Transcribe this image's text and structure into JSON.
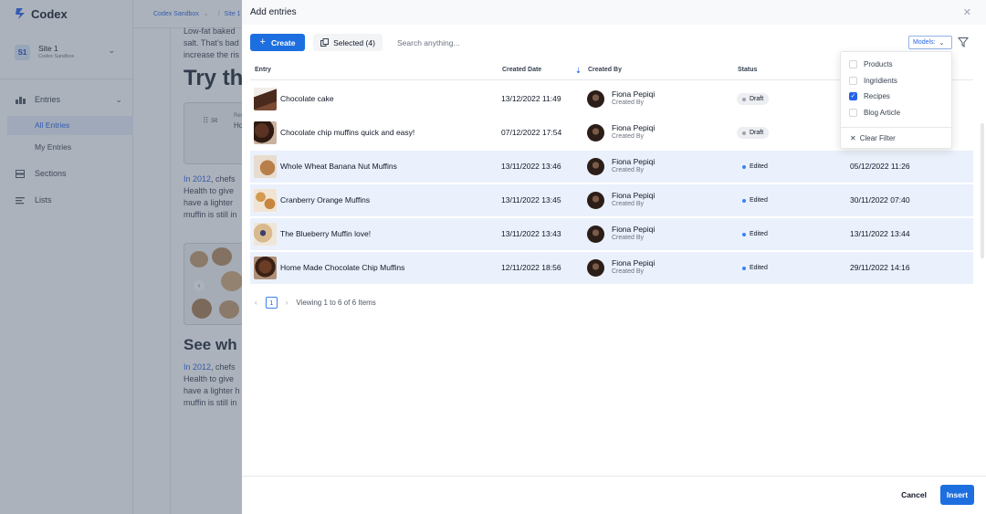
{
  "app": {
    "logo_text": "Codex",
    "site": {
      "badge": "S1",
      "name": "Site 1",
      "subtitle": "Codex Sandbox"
    },
    "nav": {
      "entries_label": "Entries",
      "all_entries_label": "All Entries",
      "my_entries_label": "My Entries",
      "sections_label": "Sections",
      "lists_label": "Lists"
    },
    "breadcrumb": [
      "Codex Sandbox",
      "Site 1"
    ],
    "background": {
      "line1": "Low-fat baked",
      "line2": "salt. That’s bad",
      "line3": "increase the ris",
      "heading1": "Try th",
      "card_label": "Rec",
      "card_title": "Ho",
      "para_link": "In 2012",
      "para_a": ", chefs",
      "para_b": "Health to give",
      "para_c": "have a lighter",
      "para_d": "muffin is still in",
      "heading2": "See wh",
      "para2_link": "In 2012",
      "para2_a": ", chefs",
      "para2_b": "Health to give",
      "para2_c": "have a lighter h",
      "para2_d": "muffin is still in"
    }
  },
  "modal": {
    "title": "Add entries",
    "create_label": "Create",
    "selected_label": "Selected (4)",
    "search_placeholder": "Search anything...",
    "models_label": "Models:",
    "columns": {
      "entry": "Entry",
      "created_date": "Created Date",
      "created_by": "Created By",
      "status": "Status"
    },
    "rows": [
      {
        "name": "Chocolate cake",
        "created_date": "13/12/2022 11:49",
        "author": "Fiona Pepiqi",
        "author_role": "Created By",
        "status": "Draft",
        "modified_date": "",
        "selected": false
      },
      {
        "name": "Chocolate chip muffins quick and easy!",
        "created_date": "07/12/2022 17:54",
        "author": "Fiona Pepiqi",
        "author_role": "Created By",
        "status": "Draft",
        "modified_date": "",
        "selected": false
      },
      {
        "name": "Whole Wheat Banana Nut Muffins",
        "created_date": "13/11/2022 13:46",
        "author": "Fiona Pepiqi",
        "author_role": "Created By",
        "status": "Edited",
        "modified_date": "05/12/2022 11:26",
        "selected": true
      },
      {
        "name": "Cranberry Orange Muffins",
        "created_date": "13/11/2022 13:45",
        "author": "Fiona Pepiqi",
        "author_role": "Created By",
        "status": "Edited",
        "modified_date": "30/11/2022 07:40",
        "selected": true
      },
      {
        "name": "The Blueberry Muffin love!",
        "created_date": "13/11/2022 13:43",
        "author": "Fiona Pepiqi",
        "author_role": "Created By",
        "status": "Edited",
        "modified_date": "13/11/2022 13:44",
        "selected": true
      },
      {
        "name": "Home Made Chocolate Chip Muffins",
        "created_date": "12/11/2022 18:56",
        "author": "Fiona Pepiqi",
        "author_role": "Created By",
        "status": "Edited",
        "modified_date": "29/11/2022 14:16",
        "selected": true
      }
    ],
    "pagination": {
      "current_page": "1",
      "summary": "Viewing 1 to 6 of 6 Items"
    },
    "model_filter": {
      "options": [
        {
          "label": "Products",
          "checked": false
        },
        {
          "label": "Ingridients",
          "checked": false
        },
        {
          "label": "Recipes",
          "checked": true
        },
        {
          "label": "Blog Article",
          "checked": false
        }
      ],
      "clear_label": "Clear Filter"
    },
    "cancel_label": "Cancel",
    "insert_label": "Insert"
  },
  "colors": {
    "primary": "#1d6fe0",
    "selected_row": "#eaf1fc",
    "overlay": "rgba(71,85,105,0.45)",
    "edited_dot": "#3b82f6",
    "draft_dot": "#9ca3af"
  },
  "icons": [
    "logo-icon",
    "chevron-down-icon",
    "entries-icon",
    "sections-icon",
    "lists-icon",
    "close-icon",
    "plus-icon",
    "copy-icon",
    "filter-icon",
    "sort-down-icon",
    "check-icon",
    "x-icon",
    "chevron-left-icon",
    "chevron-right-icon"
  ]
}
